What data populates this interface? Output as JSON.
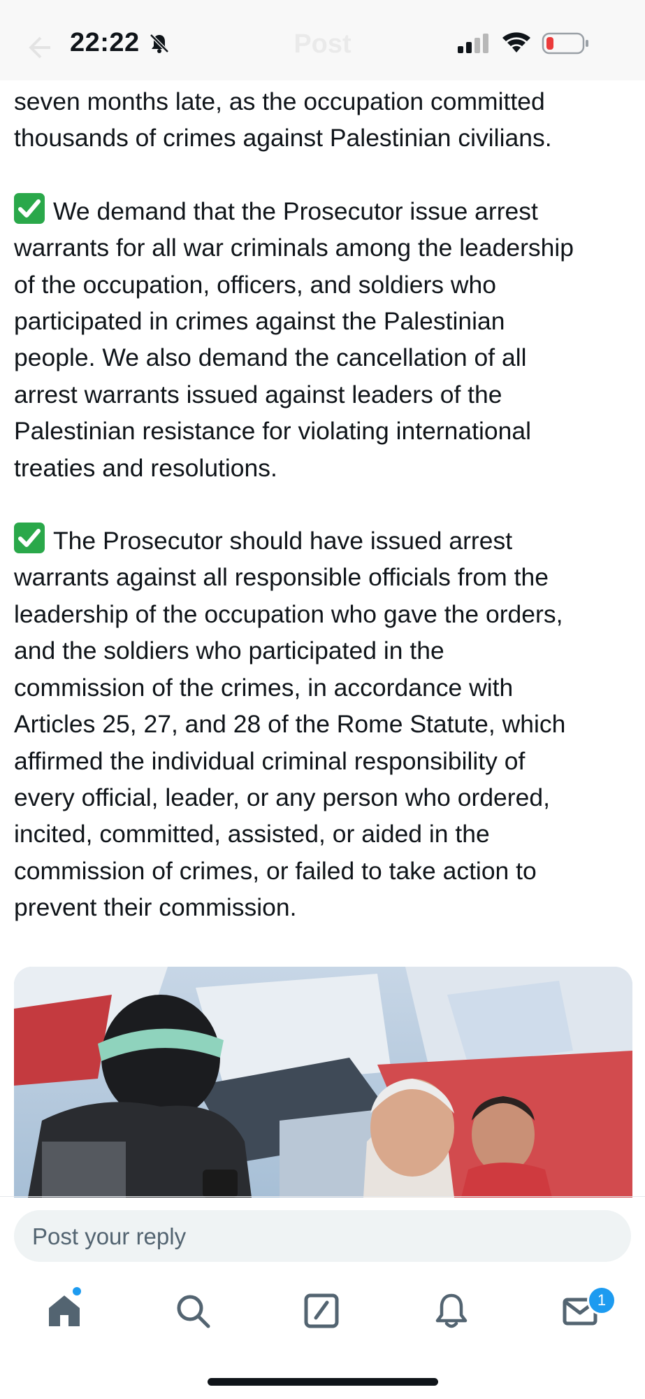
{
  "status_bar": {
    "time": "22:22"
  },
  "header": {
    "title": "Post"
  },
  "post": {
    "paragraphs": [
      "seven months late, as the occupation committed\nthousands of crimes against Palestinian civilians.",
      "We demand that the Prosecutor issue arrest\nwarrants for all war criminals among the leadership\nof the occupation, officers, and soldiers who\nparticipated in crimes against the Palestinian\npeople. We also demand the cancellation of all\narrest warrants issued against leaders of the\nPalestinian resistance for violating international\ntreaties and resolutions.",
      "The Prosecutor should have issued arrest\nwarrants against all responsible officials from the\nleadership of the occupation who gave the orders,\nand the soldiers who participated in the\ncommission of the crimes, in accordance with\nArticles 25, 27, and 28 of the Rome Statute, which\naffirmed the individual criminal responsibility of\nevery official, leader, or any person who ordered,\nincited, committed, assisted, or aided in the\ncommission of crimes, or failed to take action to\nprevent their commission."
    ]
  },
  "reply": {
    "placeholder": "Post your reply"
  },
  "tabbar": {
    "items": [
      "home-icon",
      "search-icon",
      "compose-icon",
      "notifications-icon",
      "messages-icon"
    ],
    "messages_badge": "1"
  },
  "colors": {
    "accent": "#1d9bf0",
    "check": "#2aa84a"
  }
}
